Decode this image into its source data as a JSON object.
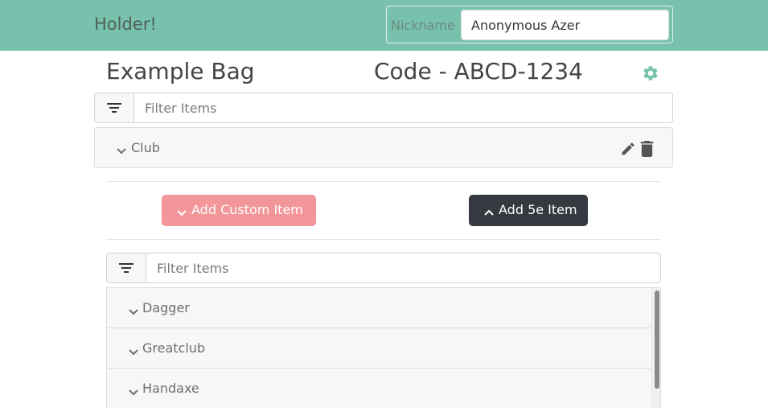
{
  "header": {
    "brand": "Holder!",
    "nickname_label": "Nickname",
    "nickname_value": "Anonymous Azer"
  },
  "bag": {
    "title": "Example Bag",
    "code": "Code - ABCD-1234",
    "filter_placeholder": "Filter Items",
    "items": [
      {
        "label": "Club"
      }
    ]
  },
  "actions": {
    "add_custom_label": "Add Custom Item",
    "add_5e_label": "Add 5e Item"
  },
  "catalog": {
    "filter_placeholder": "Filter Items",
    "items": [
      {
        "label": "Dagger"
      },
      {
        "label": "Greatclub"
      },
      {
        "label": "Handaxe"
      }
    ]
  },
  "colors": {
    "primary": "#78c2ad",
    "danger_light": "#f3969a",
    "dark": "#343a40"
  },
  "icons": {
    "filter": "filter-icon",
    "settings": "gear-icon",
    "expand": "chevron-down-icon",
    "collapse": "chevron-up-icon",
    "edit": "pencil-icon",
    "delete": "trash-icon"
  }
}
